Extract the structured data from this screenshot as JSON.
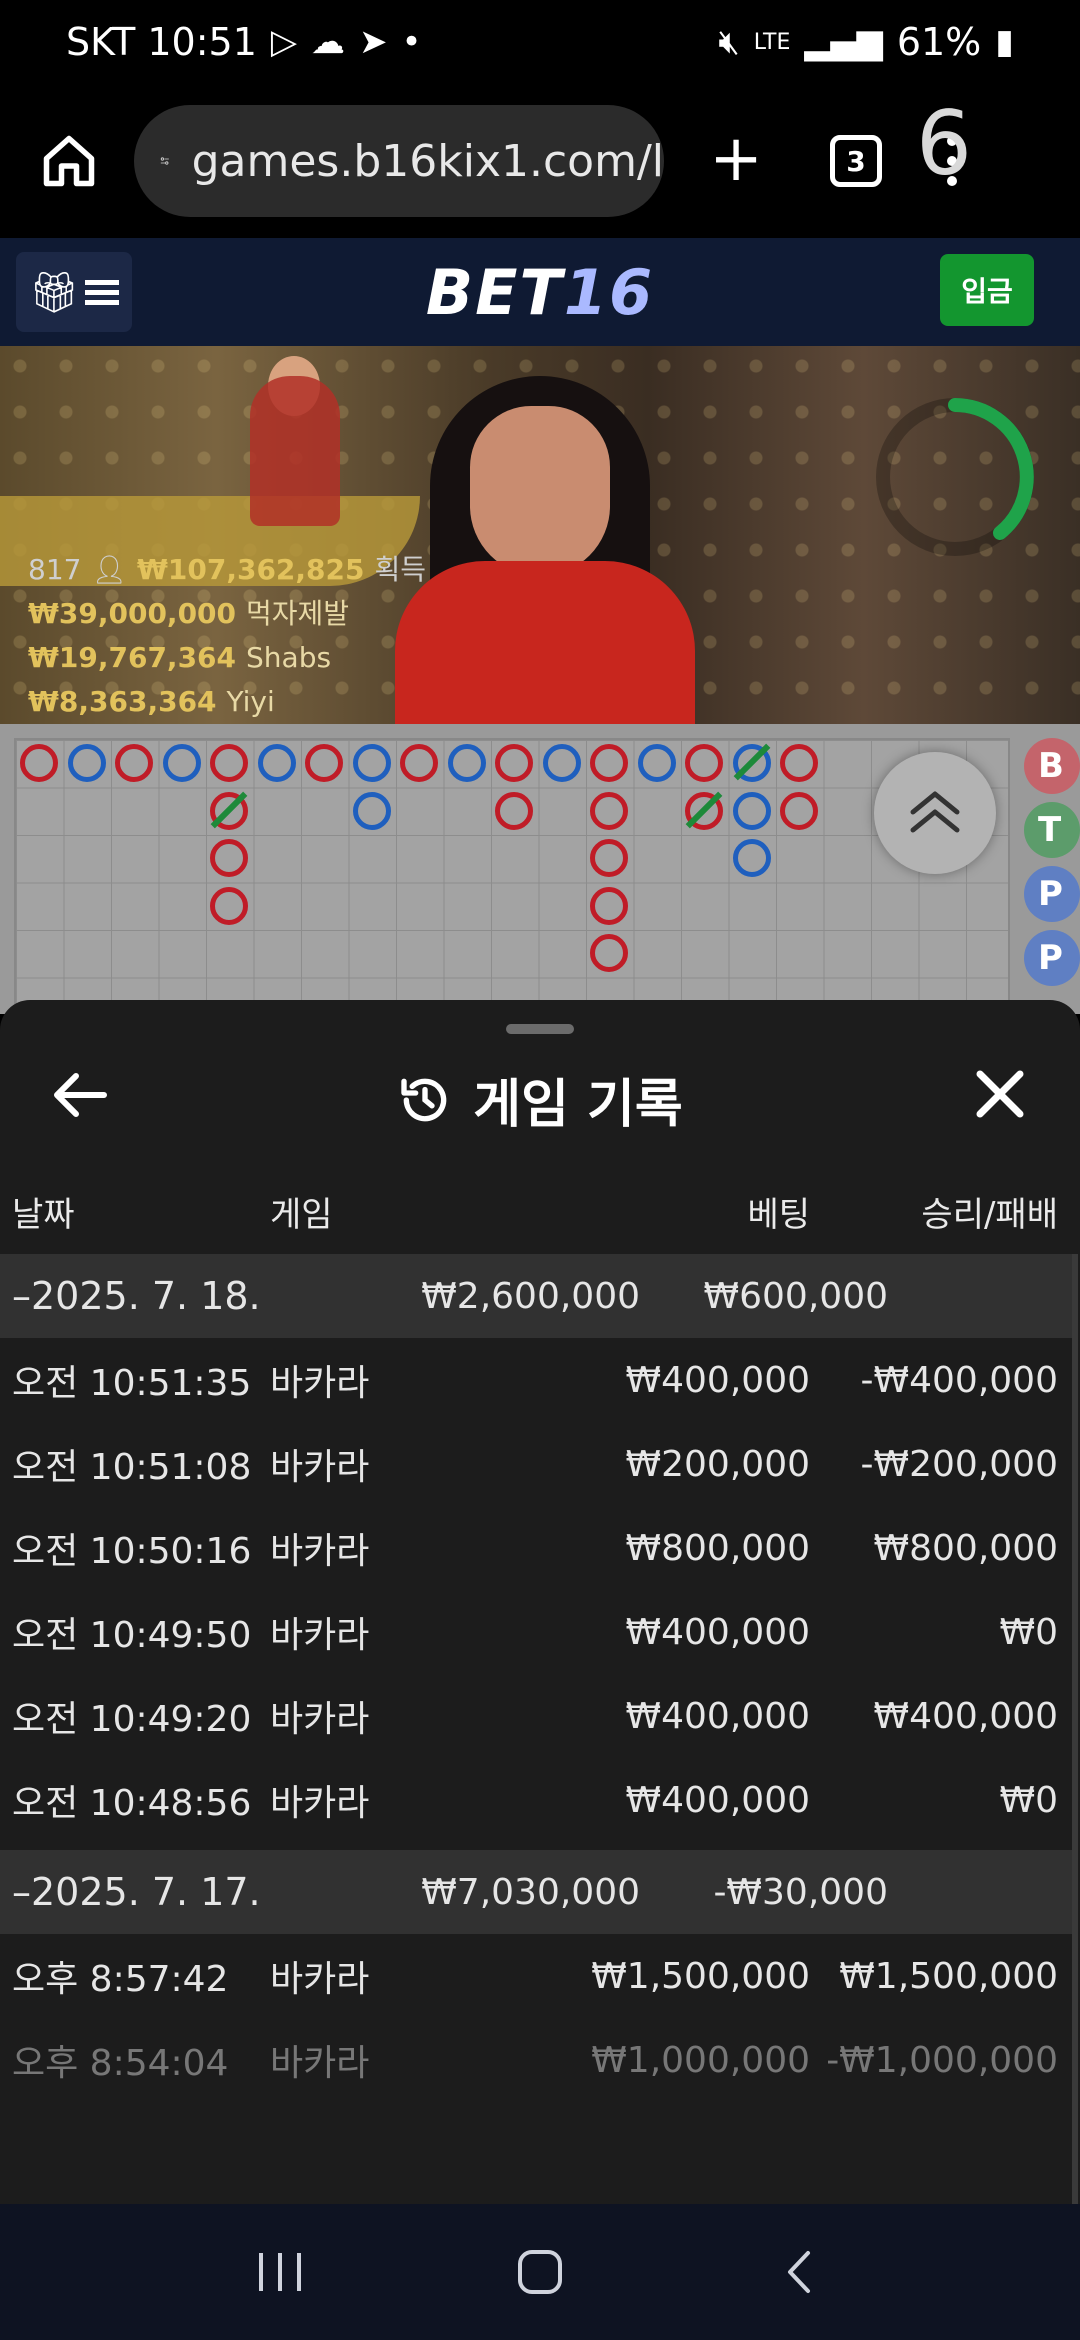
{
  "status_bar": {
    "carrier_time": "SKT 10:51",
    "battery": "61%",
    "network": "LTE"
  },
  "browser": {
    "url": "games.b16kix1.com/l",
    "tab_count": "3"
  },
  "site": {
    "logo_part1": "BET",
    "logo_part2": "16",
    "deposit_label": "입금"
  },
  "video": {
    "countdown": "6",
    "player_count": "817",
    "total_won": "₩107,362,825",
    "total_won_label": "획득",
    "winners": [
      {
        "amount": "₩39,000,000",
        "name": "먹자제발"
      },
      {
        "amount": "₩19,767,364",
        "name": "Shabs"
      },
      {
        "amount": "₩8,363,364",
        "name": "Yiyi"
      }
    ]
  },
  "scoreboard": {
    "side_buttons": [
      "B",
      "T",
      "P",
      "P"
    ]
  },
  "history": {
    "title": "게임 기록",
    "columns": {
      "date": "날짜",
      "game": "게임",
      "bet": "베팅",
      "win_loss": "승리/패배"
    },
    "groups": [
      {
        "date": "–2025. 7. 18.",
        "bet_total": "₩2,600,000",
        "win_loss_total": "₩600,000",
        "rows": [
          {
            "time": "오전 10:51:35",
            "game": "바카라",
            "bet": "₩400,000",
            "win_loss": "-₩400,000"
          },
          {
            "time": "오전 10:51:08",
            "game": "바카라",
            "bet": "₩200,000",
            "win_loss": "-₩200,000"
          },
          {
            "time": "오전 10:50:16",
            "game": "바카라",
            "bet": "₩800,000",
            "win_loss": "₩800,000"
          },
          {
            "time": "오전 10:49:50",
            "game": "바카라",
            "bet": "₩400,000",
            "win_loss": "₩0"
          },
          {
            "time": "오전 10:49:20",
            "game": "바카라",
            "bet": "₩400,000",
            "win_loss": "₩400,000"
          },
          {
            "time": "오전 10:48:56",
            "game": "바카라",
            "bet": "₩400,000",
            "win_loss": "₩0"
          }
        ]
      },
      {
        "date": "–2025. 7. 17.",
        "bet_total": "₩7,030,000",
        "win_loss_total": "-₩30,000",
        "rows": [
          {
            "time": "오후 8:57:42",
            "game": "바카라",
            "bet": "₩1,500,000",
            "win_loss": "₩1,500,000"
          },
          {
            "time": "오후 8:54:04",
            "game": "바카라",
            "bet": "₩1,000,000",
            "win_loss": "-₩1,000,000"
          }
        ]
      }
    ]
  },
  "colors": {
    "banker": "#c01c27",
    "player": "#1f5fbe",
    "tie": "#1e8a3a",
    "deposit": "#13962f"
  }
}
